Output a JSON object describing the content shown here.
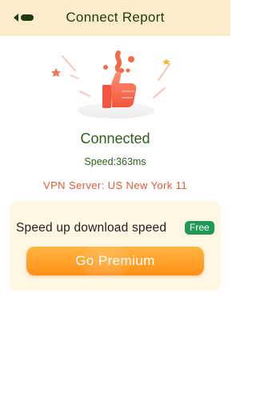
{
  "header": {
    "title": "Connect Report",
    "back_icon": "back-arrow-icon"
  },
  "status": {
    "text": "Connected",
    "speed": "Speed:363ms"
  },
  "server": {
    "label": "VPN Server: US New York 11"
  },
  "promo": {
    "text": "Speed up download speed",
    "badge": "Free",
    "button_label": "Go Premium"
  },
  "colors": {
    "header_bg": "#fbeccb",
    "status_green": "#2e5f1a",
    "server_red": "#e25a38",
    "badge_green": "#1f9a55",
    "button_orange": "#ff9018"
  }
}
